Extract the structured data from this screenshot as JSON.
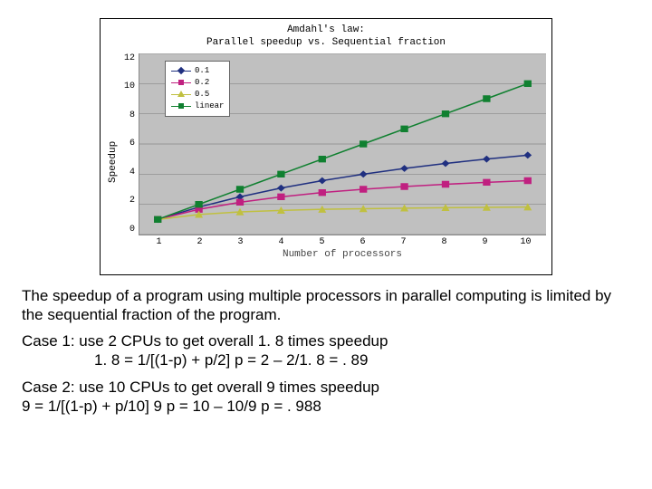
{
  "chart_data": {
    "type": "line",
    "title_line1": "Amdahl's law:",
    "title_line2": "Parallel speedup vs. Sequential fraction",
    "xlabel": "Number of processors",
    "ylabel": "Speedup",
    "x": [
      1,
      2,
      3,
      4,
      5,
      6,
      7,
      8,
      9,
      10
    ],
    "yticks": [
      0,
      2,
      4,
      6,
      8,
      10,
      12
    ],
    "ylim": [
      0,
      12
    ],
    "series": [
      {
        "name": "0.1",
        "color": "#203080",
        "marker": "diamond",
        "values": [
          1,
          1.82,
          2.5,
          3.08,
          3.57,
          4.0,
          4.38,
          4.71,
          5.0,
          5.26
        ]
      },
      {
        "name": "0.2",
        "color": "#c02080",
        "marker": "square",
        "values": [
          1,
          1.67,
          2.14,
          2.5,
          2.78,
          3.0,
          3.18,
          3.33,
          3.46,
          3.57
        ]
      },
      {
        "name": "0.5",
        "color": "#c0c040",
        "marker": "triangle",
        "values": [
          1,
          1.33,
          1.5,
          1.6,
          1.67,
          1.71,
          1.75,
          1.78,
          1.8,
          1.82
        ]
      },
      {
        "name": "linear",
        "color": "#108030",
        "marker": "square",
        "values": [
          1,
          2,
          3,
          4,
          5,
          6,
          7,
          8,
          9,
          10
        ]
      }
    ],
    "legend_pos": "top-left"
  },
  "text": {
    "caption": "The speedup of a program using multiple processors in parallel computing is limited by the sequential fraction of the program.",
    "case1_l1": "Case 1:  use 2 CPUs to get overall 1. 8 times speedup",
    "case1_l2": "1. 8 = 1/[(1-p) + p/2]   p = 2 – 2/1. 8 = . 89",
    "case2_l1": "Case 2:  use 10 CPUs to get overall 9 times speedup",
    "case2_l2": "9 = 1/[(1-p) + p/10]   9 p = 10 – 10/9        p = . 988"
  }
}
